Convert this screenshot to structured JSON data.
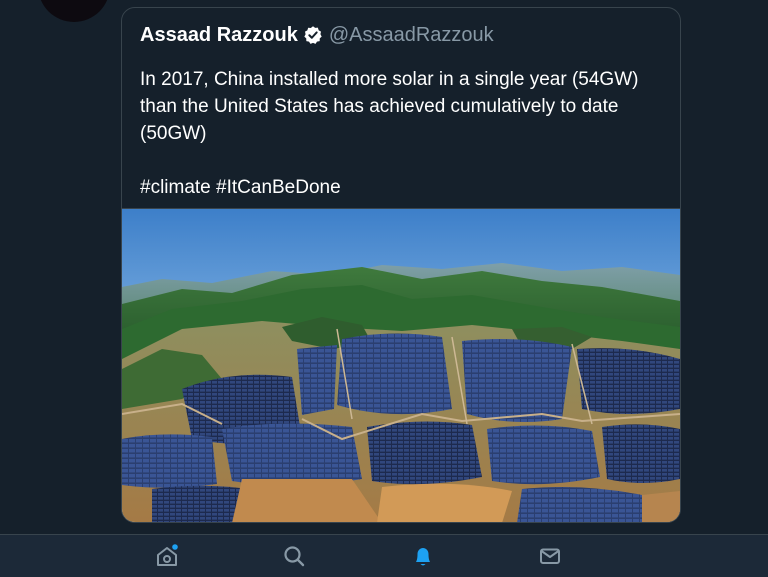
{
  "quoted_tweet": {
    "display_name": "Assaad Razzouk",
    "handle": "@AssaadRazzouk",
    "verified": true,
    "text_line_1": "In 2017, China installed more solar in a single year (54GW)",
    "text_line_2": "than the United States has achieved cumulatively to date",
    "text_line_3": "(50GW)",
    "hashtags": "#climate #ItCanBeDone",
    "image_icon": "aerial-solar-farm-photo"
  },
  "bottom_nav": {
    "tabs": [
      {
        "name": "home",
        "icon": "home-icon",
        "active": false,
        "has_dot": true
      },
      {
        "name": "search",
        "icon": "search-icon",
        "active": false
      },
      {
        "name": "notifications",
        "icon": "bell-icon",
        "active": true
      },
      {
        "name": "messages",
        "icon": "mail-icon",
        "active": false
      }
    ]
  },
  "colors": {
    "background": "#15202b",
    "border": "#38444d",
    "secondary_text": "#8899a6",
    "accent": "#1da1f2"
  }
}
